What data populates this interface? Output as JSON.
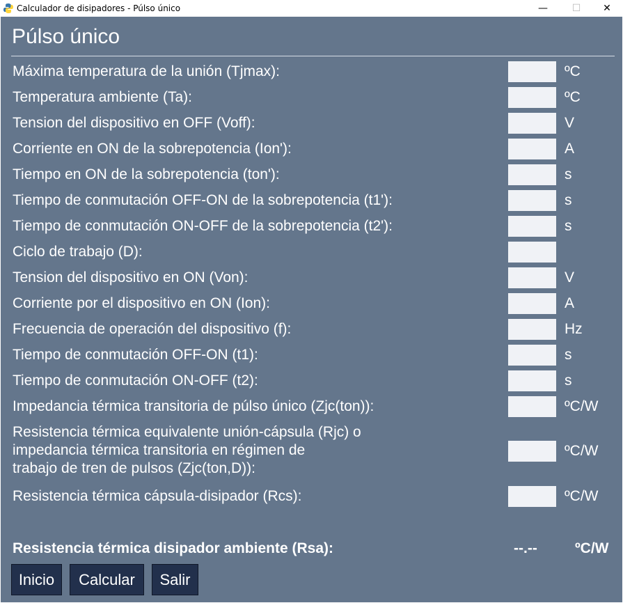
{
  "window": {
    "title": "Calculador de disipadores - Púlso único",
    "minimize": "—",
    "maximize": "☐",
    "close": "✕"
  },
  "heading": "Púlso único",
  "rows": [
    {
      "label": "Máxima temperatura de la unión (Tjmax):",
      "unit": "ºC",
      "value": ""
    },
    {
      "label": "Temperatura ambiente (Ta):",
      "unit": "ºC",
      "value": ""
    },
    {
      "label": "Tension del dispositivo en OFF (Voff):",
      "unit": "V",
      "value": ""
    },
    {
      "label": "Corriente en ON de la sobrepotencia (Ion'):",
      "unit": "A",
      "value": ""
    },
    {
      "label": "Tiempo en ON de la sobrepotencia (ton'):",
      "unit": "s",
      "value": ""
    },
    {
      "label": "Tiempo de conmutación OFF-ON de la sobrepotencia (t1'):",
      "unit": "s",
      "value": ""
    },
    {
      "label": "Tiempo de conmutación ON-OFF de la sobrepotencia (t2'):",
      "unit": "s",
      "value": ""
    },
    {
      "label": "Ciclo de trabajo (D):",
      "unit": "",
      "value": ""
    },
    {
      "label": "Tension del dispositivo en ON (Von):",
      "unit": "V",
      "value": ""
    },
    {
      "label": "Corriente por el dispositivo en ON (Ion):",
      "unit": "A",
      "value": ""
    },
    {
      "label": "Frecuencia de operación del dispositivo (f):",
      "unit": "Hz",
      "value": ""
    },
    {
      "label": "Tiempo de conmutación OFF-ON (t1):",
      "unit": "s",
      "value": ""
    },
    {
      "label": "Tiempo de conmutación ON-OFF (t2):",
      "unit": "s",
      "value": ""
    },
    {
      "label": "Impedancia térmica transitoria de púlso único (Zjc(ton)):",
      "unit": "ºC/W",
      "value": ""
    },
    {
      "label": "Resistencia térmica equivalente unión-cápsula (Rjc) o\nimpedancia térmica transitoria en régimen de\ntrabajo de tren de pulsos (Zjc(ton,D)):",
      "unit": "ºC/W",
      "value": ""
    },
    {
      "label": "Resistencia térmica cápsula-disipador (Rcs):",
      "unit": "ºC/W",
      "value": ""
    }
  ],
  "result": {
    "label": "Resistencia térmica disipador ambiente (Rsa):",
    "value": "--.--",
    "unit": "ºC/W"
  },
  "buttons": {
    "inicio": "Inicio",
    "calcular": "Calcular",
    "salir": "Salir"
  },
  "colors": {
    "background": "#64768c",
    "field": "#f0f2f6",
    "button": "#22304c",
    "text": "#ffffff"
  }
}
